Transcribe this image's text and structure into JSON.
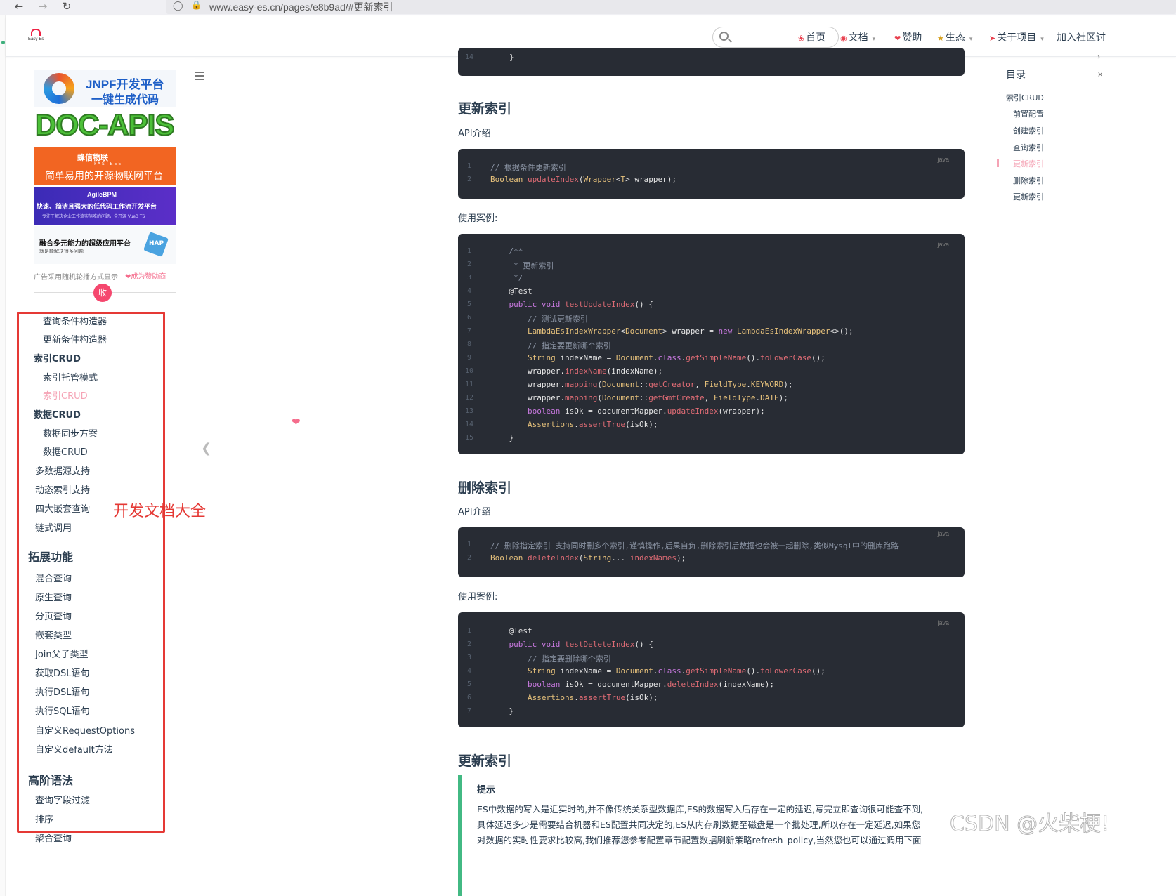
{
  "browser": {
    "url": "www.easy-es.cn/pages/e8b9ad/#更新索引"
  },
  "header": {
    "logo_text": "Easy-Es",
    "search_placeholder": "",
    "nav": [
      {
        "label": "首页",
        "icon": "home-icon"
      },
      {
        "label": "文档",
        "icon": "doc-icon",
        "dropdown": true
      },
      {
        "label": "赞助",
        "icon": "heart-icon"
      },
      {
        "label": "生态",
        "icon": "eco-icon",
        "dropdown": true
      },
      {
        "label": "关于项目",
        "icon": "rocket-icon",
        "dropdown": true
      },
      {
        "label": "加入社区讨"
      }
    ]
  },
  "ads": {
    "jnpf_line1": "JNPF开发平台",
    "jnpf_line2": "一键生成代码",
    "docapis": "DOC-APIS",
    "fastbee_line1": "蜂信物联",
    "fastbee_sub": "FASTBEE",
    "fastbee_line2": "简单易用的开源物联网平台",
    "agile_line1": "AgileBPM",
    "agile_line2": "快速、简洁且强大的低代码工作流开发平台",
    "agile_line3": "专注于解决企业工作流实施难的问题，全开源 Vue3 TS",
    "fuse_line1": "融合多元能力的超级应用平台",
    "fuse_line2": "就是能解决很多问题",
    "fuse_badge": "HAP",
    "note": "广告采用随机轮播方式显示",
    "sponsor": "成为赞助商",
    "collapse": "收"
  },
  "sidebar": {
    "items": [
      {
        "label": "查询条件构造器",
        "level": 2
      },
      {
        "label": "更新条件构造器",
        "level": 2
      },
      {
        "label": "索引CRUD",
        "level": 1,
        "bold": true
      },
      {
        "label": "索引托管模式",
        "level": 2
      },
      {
        "label": "索引CRUD",
        "level": 2,
        "active": true
      },
      {
        "label": "数据CRUD",
        "level": 1,
        "bold": true
      },
      {
        "label": "数据同步方案",
        "level": 2
      },
      {
        "label": "数据CRUD",
        "level": 2
      },
      {
        "label": "多数据源支持",
        "level": 1
      },
      {
        "label": "动态索引支持",
        "level": 1
      },
      {
        "label": "四大嵌套查询",
        "level": 1
      },
      {
        "label": "链式调用",
        "level": 1
      },
      {
        "label": "拓展功能",
        "level": 0
      },
      {
        "label": "混合查询",
        "level": 1
      },
      {
        "label": "原生查询",
        "level": 1
      },
      {
        "label": "分页查询",
        "level": 1
      },
      {
        "label": "嵌套类型",
        "level": 1
      },
      {
        "label": "Join父子类型",
        "level": 1
      },
      {
        "label": "获取DSL语句",
        "level": 1
      },
      {
        "label": "执行DSL语句",
        "level": 1
      },
      {
        "label": "执行SQL语句",
        "level": 1
      },
      {
        "label": "自定义RequestOptions",
        "level": 1
      },
      {
        "label": "自定义default方法",
        "level": 1
      },
      {
        "label": "高阶语法",
        "level": 0
      },
      {
        "label": "查询字段过滤",
        "level": 1
      },
      {
        "label": "排序",
        "level": 1
      },
      {
        "label": "聚合查询",
        "level": 1
      }
    ],
    "annotation": "开发文档大全"
  },
  "content": {
    "top_code": {
      "line_no": "14",
      "text": "}"
    },
    "section1": {
      "title": "更新索引",
      "api_intro": "API介绍",
      "api_code": {
        "lang": "java",
        "lines": [
          "// 根据条件更新索引",
          "Boolean updateIndex(Wrapper<T> wrapper);"
        ]
      },
      "usage": "使用案例:",
      "usage_code": {
        "lang": "java",
        "lines": [
          "    /**",
          "     * 更新索引",
          "     */",
          "    @Test",
          "    public void testUpdateIndex() {",
          "        // 测试更新索引",
          "        LambdaEsIndexWrapper<Document> wrapper = new LambdaEsIndexWrapper<>();",
          "        // 指定要更新哪个索引",
          "        String indexName = Document.class.getSimpleName().toLowerCase();",
          "        wrapper.indexName(indexName);",
          "        wrapper.mapping(Document::getCreator, FieldType.KEYWORD);",
          "        wrapper.mapping(Document::getGmtCreate, FieldType.DATE);",
          "        boolean isOk = documentMapper.updateIndex(wrapper);",
          "        Assertions.assertTrue(isOk);",
          "    }"
        ]
      }
    },
    "section2": {
      "title": "删除索引",
      "api_intro": "API介绍",
      "api_code": {
        "lang": "java",
        "lines": [
          "// 删除指定索引 支持同时删多个索引,谨慎操作,后果自负,删除索引后数据也会被一起删除,类似Mysql中的删库跑路",
          "Boolean deleteIndex(String... indexNames);"
        ]
      },
      "usage": "使用案例:",
      "usage_code": {
        "lang": "java",
        "lines": [
          "    @Test",
          "    public void testDeleteIndex() {",
          "        // 指定要删除哪个索引",
          "        String indexName = Document.class.getSimpleName().toLowerCase();",
          "        boolean isOk = documentMapper.deleteIndex(indexName);",
          "        Assertions.assertTrue(isOk);",
          "    }"
        ]
      }
    },
    "section3": {
      "title": "更新索引",
      "tip_title": "提示",
      "tip_lines": [
        "ES中数据的写入是近实时的,并不像传统关系型数据库,ES的数据写入后存在一定的延迟,写完立即查询很可能查不到,",
        "具体延迟多少是需要结合机器和ES配置共同决定的,ES从内存刷数据至磁盘是一个批处理,所以存在一定延迟,如果您",
        "对数据的实时性要求比较高,我们推荐您参考配置章节配置数据刷新策略refresh_policy,当然您也可以通过调用下面"
      ]
    }
  },
  "toc": {
    "title": "目录",
    "items": [
      {
        "label": "索引CRUD",
        "sub": false
      },
      {
        "label": "前置配置",
        "sub": true
      },
      {
        "label": "创建索引",
        "sub": true
      },
      {
        "label": "查询索引",
        "sub": true
      },
      {
        "label": "更新索引",
        "sub": true,
        "active": true
      },
      {
        "label": "删除索引",
        "sub": true
      },
      {
        "label": "更新索引",
        "sub": true
      }
    ]
  },
  "watermark": "CSDN @火柴梗!",
  "colors": {
    "accent": "#3eaf7c",
    "active_link": "#f5a3b5",
    "code_bg": "#282c34",
    "annotation_red": "#e53935",
    "tip_border": "#42b983"
  }
}
